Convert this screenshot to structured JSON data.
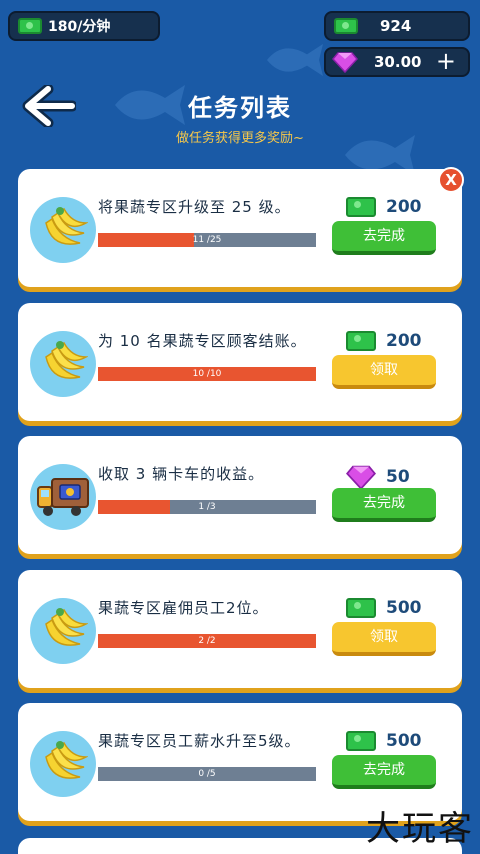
{
  "hud": {
    "income_rate": "180/分钟",
    "cash": "924",
    "gems": "30.00",
    "add_symbol": "+"
  },
  "header": {
    "title": "任务列表",
    "subtitle": "做任务获得更多奖励~",
    "back_icon": "arrow-left-icon"
  },
  "tasks": [
    {
      "icon": "bananas-icon",
      "text": "将果蔬专区升级至 25 级。",
      "progress_label": "11 /25",
      "progress": 0.44,
      "reward_type": "cash",
      "reward": "200",
      "button": "去完成",
      "button_style": "green",
      "close": "X"
    },
    {
      "icon": "bananas-icon",
      "text": "为 10 名果蔬专区顾客结账。",
      "progress_label": "10 /10",
      "progress": 1.0,
      "reward_type": "cash",
      "reward": "200",
      "button": "领取",
      "button_style": "yellow"
    },
    {
      "icon": "truck-icon",
      "text": "收取 3 辆卡车的收益。",
      "progress_label": "1 /3",
      "progress": 0.33,
      "reward_type": "gem",
      "reward": "50",
      "button": "去完成",
      "button_style": "green"
    },
    {
      "icon": "bananas-icon",
      "text": "果蔬专区雇佣员工2位。",
      "progress_label": "2 /2",
      "progress": 1.0,
      "reward_type": "cash",
      "reward": "500",
      "button": "领取",
      "button_style": "yellow"
    },
    {
      "icon": "bananas-icon",
      "text": "果蔬专区员工薪水升至5级。",
      "progress_label": "0 /5",
      "progress": 0.0,
      "reward_type": "cash",
      "reward": "500",
      "button": "去完成",
      "button_style": "green"
    }
  ],
  "watermark": "大玩客",
  "colors": {
    "background": "#1a5aa6",
    "progress_fill": "#e85530",
    "button_green": "#3fbf37",
    "button_yellow": "#f7c62f",
    "subtitle": "#f7c84a"
  }
}
